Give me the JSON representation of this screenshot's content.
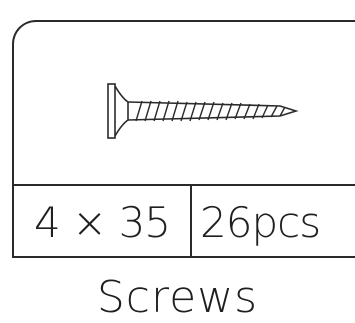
{
  "product": {
    "size_label": "4 × 35",
    "count_label": "26pcs",
    "caption": "Screws",
    "icon": "screw-icon"
  }
}
